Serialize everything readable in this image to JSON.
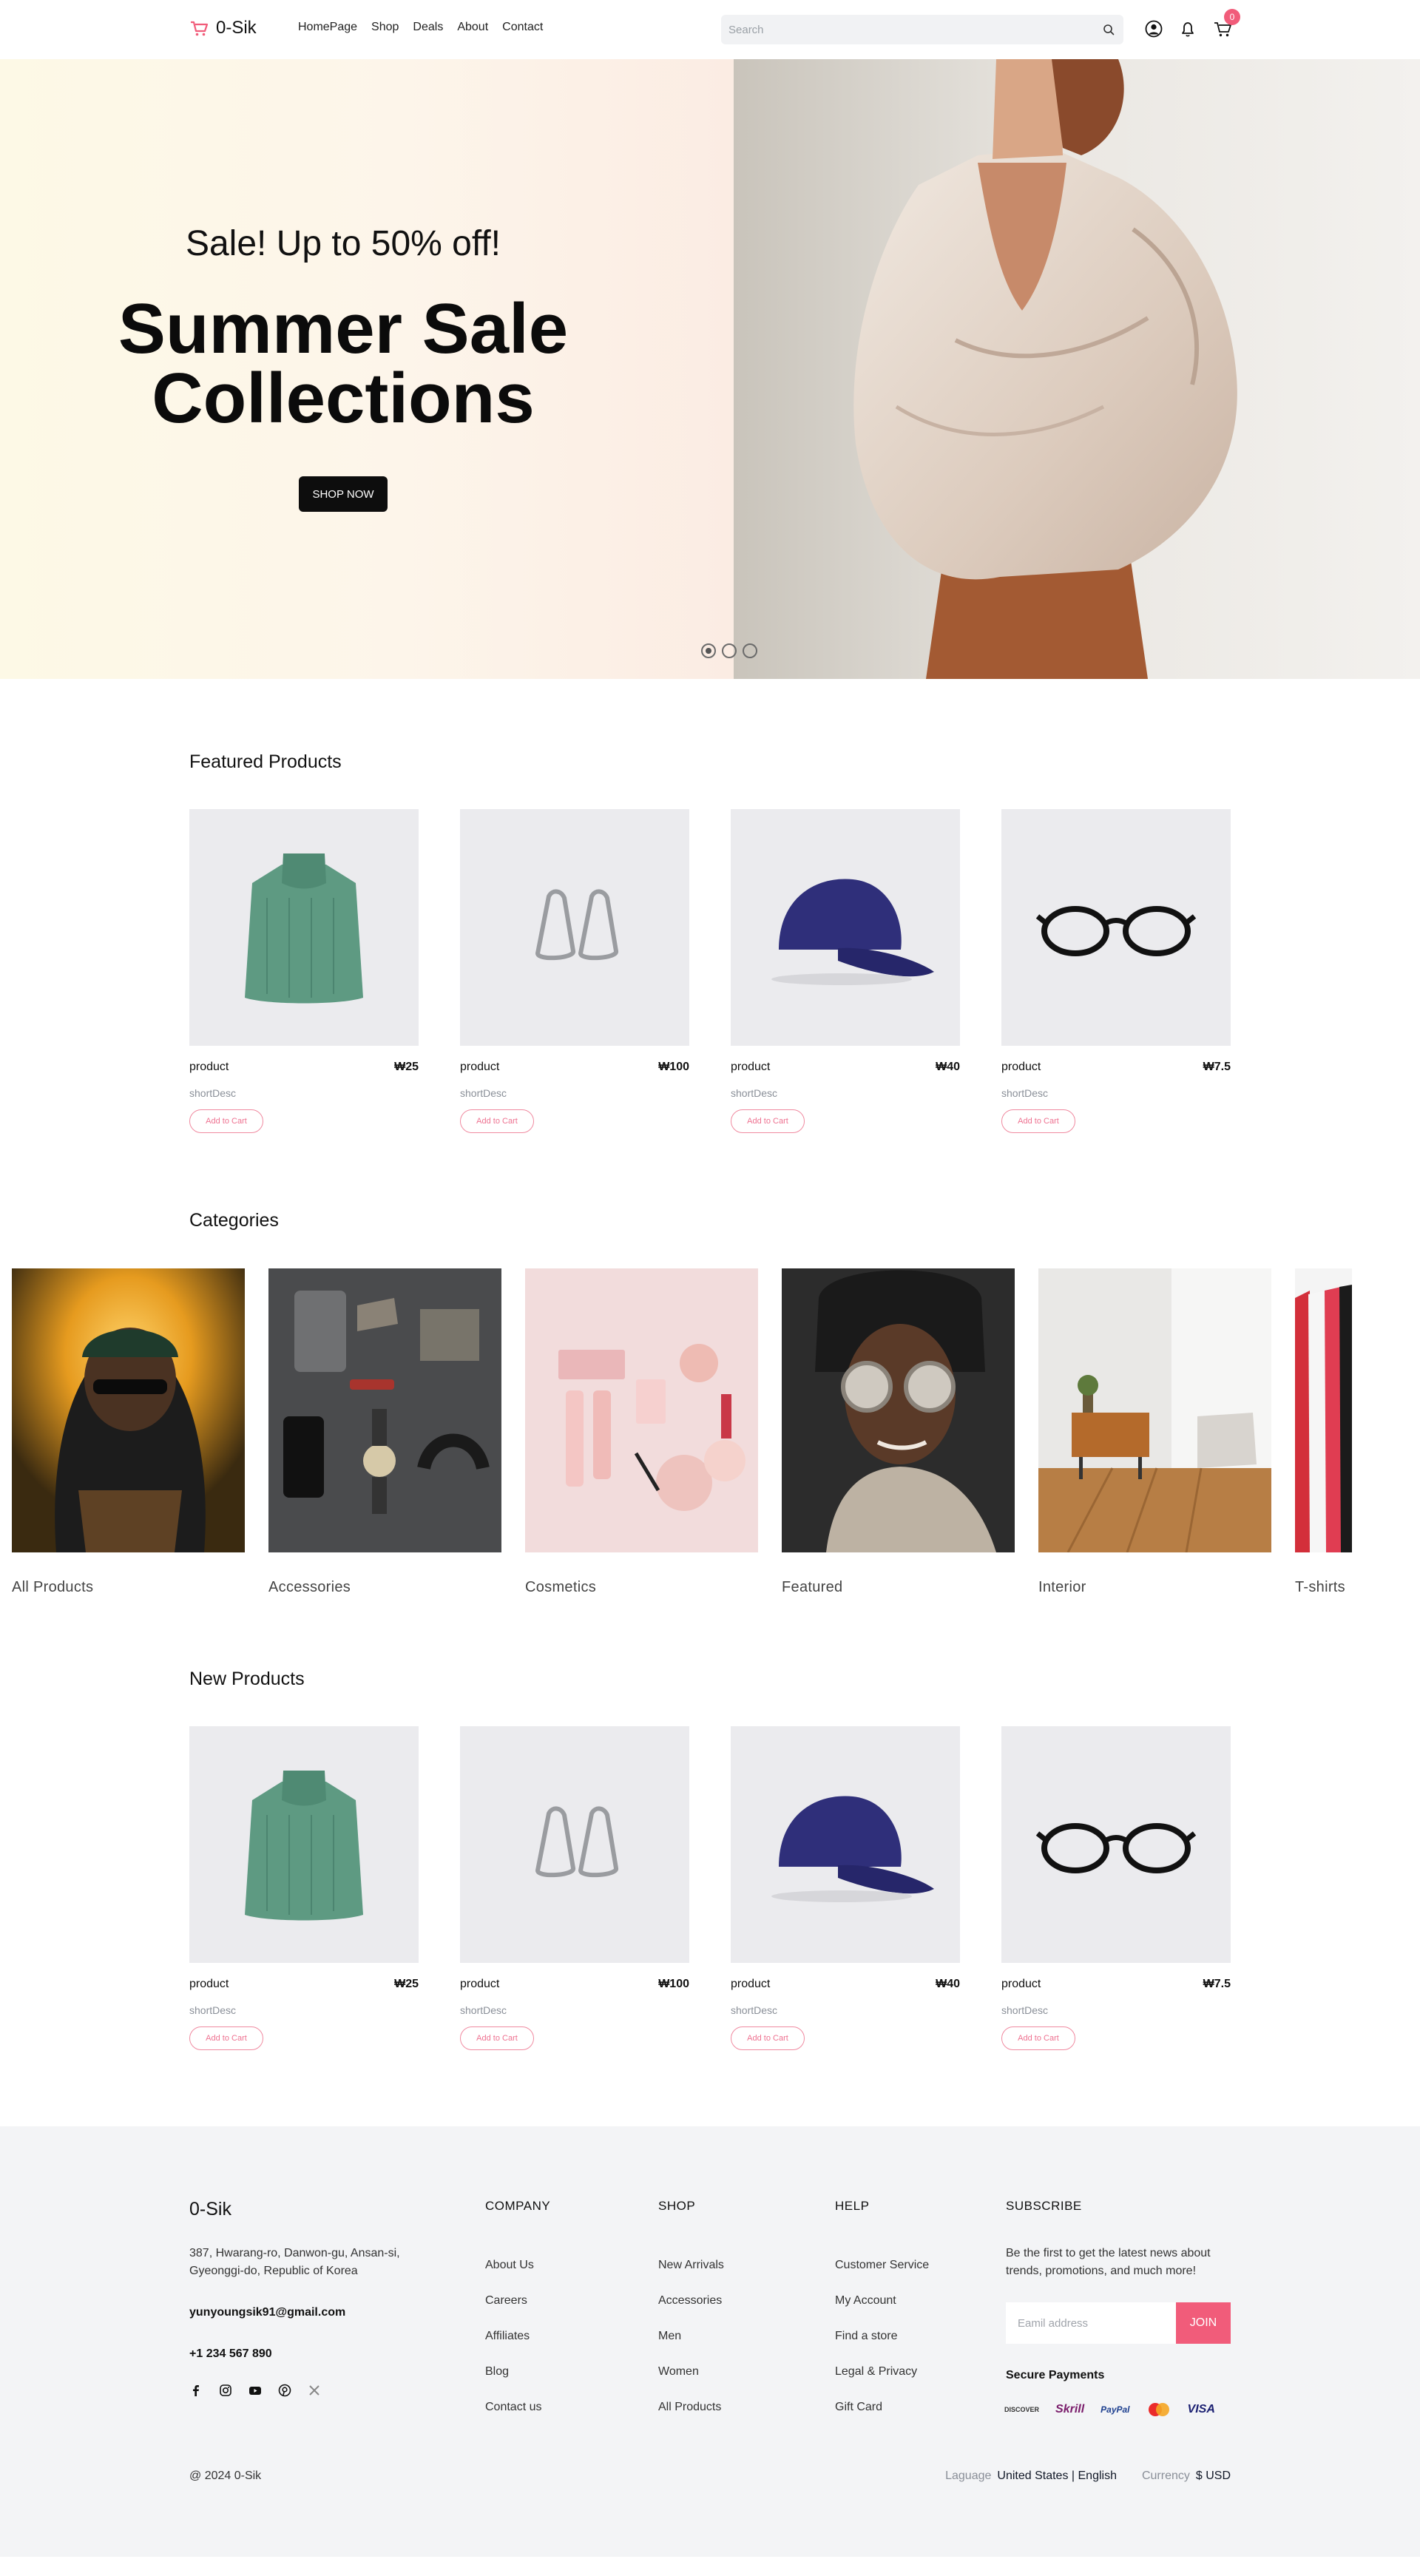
{
  "header": {
    "brand": "0-Sik",
    "nav": [
      "HomePage",
      "Shop",
      "Deals",
      "About",
      "Contact"
    ],
    "search_placeholder": "Search",
    "cart_count": "0",
    "accent": "#f15c7a"
  },
  "hero": {
    "subtitle": "Sale! Up to 50% off!",
    "title_line1": "Summer Sale",
    "title_line2": "Collections",
    "button": "SHOP NOW",
    "slides": 3,
    "active_slide": 1
  },
  "featured": {
    "title": "Featured Products",
    "items": [
      {
        "name": "product",
        "price": "₩25",
        "desc": "shortDesc",
        "button": "Add to Cart",
        "image": "green-sweater"
      },
      {
        "name": "product",
        "price": "₩100",
        "desc": "shortDesc",
        "button": "Add to Cart",
        "image": "silver-earrings"
      },
      {
        "name": "product",
        "price": "₩40",
        "desc": "shortDesc",
        "button": "Add to Cart",
        "image": "navy-cap"
      },
      {
        "name": "product",
        "price": "₩7.5",
        "desc": "shortDesc",
        "button": "Add to Cart",
        "image": "black-glasses"
      }
    ]
  },
  "categories": {
    "title": "Categories",
    "items": [
      {
        "label": "All Products"
      },
      {
        "label": "Accessories"
      },
      {
        "label": "Cosmetics"
      },
      {
        "label": "Featured"
      },
      {
        "label": "Interior"
      },
      {
        "label": "T-shirts"
      }
    ]
  },
  "new_products": {
    "title": "New Products",
    "items": [
      {
        "name": "product",
        "price": "₩25",
        "desc": "shortDesc",
        "button": "Add to Cart",
        "image": "green-sweater"
      },
      {
        "name": "product",
        "price": "₩100",
        "desc": "shortDesc",
        "button": "Add to Cart",
        "image": "silver-earrings"
      },
      {
        "name": "product",
        "price": "₩40",
        "desc": "shortDesc",
        "button": "Add to Cart",
        "image": "navy-cap"
      },
      {
        "name": "product",
        "price": "₩7.5",
        "desc": "shortDesc",
        "button": "Add to Cart",
        "image": "black-glasses"
      }
    ]
  },
  "footer": {
    "brand": "0-Sik",
    "address": "387, Hwarang-ro, Danwon-gu, Ansan-si, Gyeonggi-do, Republic of Korea",
    "email": "yunyoungsik91@gmail.com",
    "phone": "+1 234 567 890",
    "socials": [
      "facebook-icon",
      "instagram-icon",
      "youtube-icon",
      "pinterest-icon",
      "x-icon"
    ],
    "company": {
      "title": "COMPANY",
      "links": [
        "About Us",
        "Careers",
        "Affiliates",
        "Blog",
        "Contact us"
      ]
    },
    "shop": {
      "title": "SHOP",
      "links": [
        "New Arrivals",
        "Accessories",
        "Men",
        "Women",
        "All Products"
      ]
    },
    "help": {
      "title": "HELP",
      "links": [
        "Customer Service",
        "My Account",
        "Find a store",
        "Legal & Privacy",
        "Gift Card"
      ]
    },
    "subscribe": {
      "title": "SUBSCRIBE",
      "text": "Be the first to get the latest news about trends, promotions, and much more!",
      "placeholder": "Eamil address",
      "button": "JOIN",
      "secure_label": "Secure Payments",
      "payments": [
        "DISCOVER",
        "Skrill",
        "PayPal",
        "Mastercard",
        "VISA"
      ]
    },
    "copyright": "@ 2024 0-Sik",
    "language_label": "Laguage",
    "language_value": "United States | English",
    "currency_label": "Currency",
    "currency_value": "$ USD"
  }
}
